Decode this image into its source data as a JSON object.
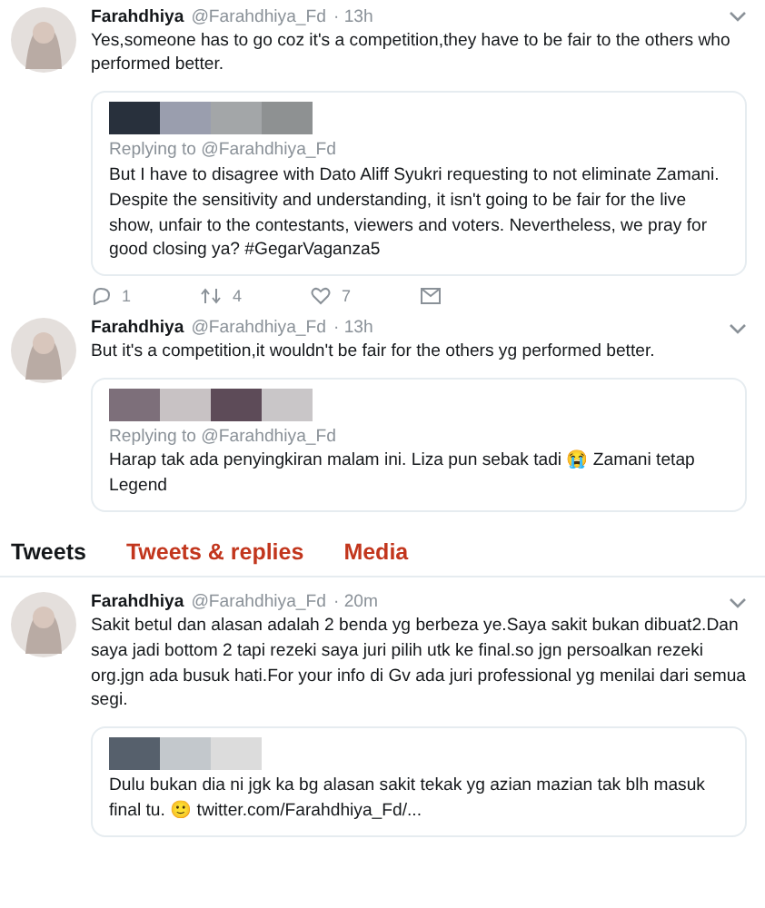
{
  "tweets_top": [
    {
      "name": "Farahdhiya",
      "handle": "@Farahdhiya_Fd",
      "time": "· 13h",
      "text": "Yes,someone has to go coz it's a competition,they have to be fair to the others who performed better.",
      "quote": {
        "replying": "Replying to @Farahdhiya_Fd",
        "text": "But I have to disagree with Dato Aliff Syukri requesting to not eliminate Zamani. Despite the sensitivity and understanding, it isn't going to be fair for the live show, unfair to the contestants, viewers and voters. Nevertheless, we pray for good closing ya? #GegarVaganza5"
      },
      "actions": [
        "1",
        "4",
        "7"
      ]
    },
    {
      "name": "Farahdhiya",
      "handle": "@Farahdhiya_Fd",
      "time": "· 13h",
      "text": "But it's a competition,it wouldn't be fair for the others yg performed better.",
      "quote": {
        "replying": "Replying to @Farahdhiya_Fd",
        "text": "Harap tak ada penyingkiran malam ini. Liza pun sebak tadi 😭 Zamani tetap Legend"
      }
    }
  ],
  "tabs": [
    {
      "label": "Tweets",
      "selected": true
    },
    {
      "label": "Tweets & replies",
      "selected": false
    },
    {
      "label": "Media",
      "selected": false
    }
  ],
  "tweets_bottom": [
    {
      "name": "Farahdhiya",
      "handle": "@Farahdhiya_Fd",
      "time": "· 20m",
      "text": "Sakit betul dan alasan adalah 2 benda yg berbeza ye.Saya sakit bukan dibuat2.Dan saya jadi bottom 2 tapi rezeki saya juri pilih utk ke final.so jgn persoalkan rezeki org.jgn ada busuk hati.For your info di Gv ada juri professional yg menilai dari semua segi.",
      "quote": {
        "text": "Dulu bukan dia ni jgk ka bg alasan sakit tekak yg azian mazian tak blh masuk final tu. 🙂",
        "link": "twitter.com/Farahdhiya_Fd/..."
      }
    }
  ]
}
